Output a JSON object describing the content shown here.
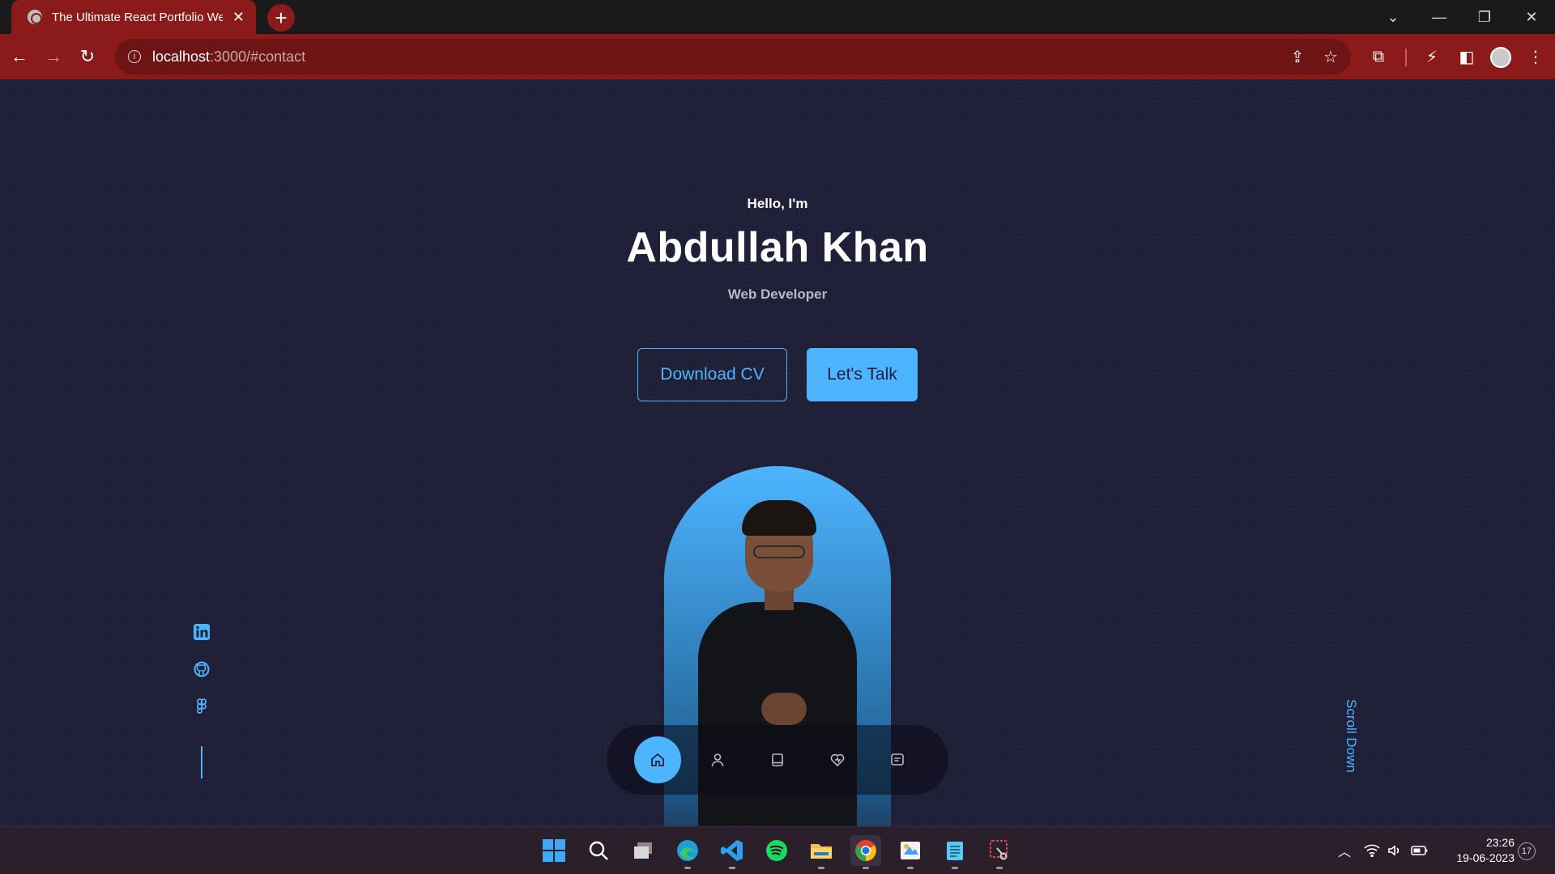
{
  "browser": {
    "tab_title": "The Ultimate React Portfolio We",
    "url_host": "localhost",
    "url_rest": ":3000/#contact"
  },
  "hero": {
    "greeting": "Hello, I'm",
    "name": "Abdullah Khan",
    "role": "Web Developer",
    "download_cv": "Download CV",
    "lets_talk": "Let's Talk",
    "scroll_down": "Scroll Down"
  },
  "socials": [
    "linkedin-icon",
    "github-icon",
    "figma-icon"
  ],
  "floating_nav": [
    "home-icon",
    "user-icon",
    "book-icon",
    "services-icon",
    "message-icon"
  ],
  "taskbar": {
    "time": "23:26",
    "date": "19-06-2023",
    "notifications": "17"
  },
  "colors": {
    "background": "#1f1f38",
    "accent": "#4db5ff",
    "browser_chrome": "#8b1a1a"
  }
}
